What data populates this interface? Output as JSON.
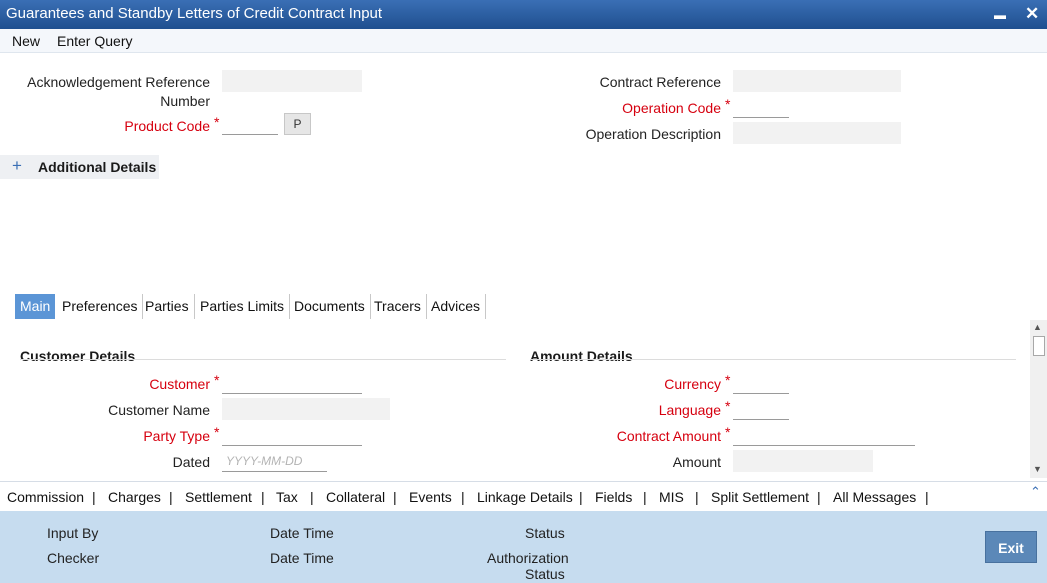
{
  "window": {
    "title": "Guarantees and Standby Letters of Credit Contract Input",
    "minimize_icon": "minimize-icon",
    "close_icon": "close-icon",
    "minimize_glyph": "▬",
    "close_glyph": "✕"
  },
  "menu": {
    "new": "New",
    "enter_query": "Enter Query"
  },
  "header": {
    "ack_ref_label_line1": "Acknowledgement Reference",
    "ack_ref_label_line2": "Number",
    "product_code_label": "Product Code",
    "p_button": "P",
    "contract_ref_label": "Contract Reference",
    "operation_code_label": "Operation Code",
    "operation_desc_label": "Operation Description",
    "required_mark": "*"
  },
  "additional_details": {
    "toggle": "+",
    "label": "Additional Details"
  },
  "tabs": [
    "Main",
    "Preferences",
    "Parties",
    "Parties Limits",
    "Documents",
    "Tracers",
    "Advices"
  ],
  "main": {
    "customer_details": {
      "title": "Customer Details",
      "customer_label": "Customer",
      "customer_name_label": "Customer Name",
      "party_type_label": "Party Type",
      "dated_label": "Dated",
      "dated_placeholder": "YYYY-MM-DD"
    },
    "amount_details": {
      "title": "Amount Details",
      "currency_label": "Currency",
      "language_label": "Language",
      "contract_amount_label": "Contract Amount",
      "amount_label": "Amount"
    }
  },
  "subscreens": [
    "Commission",
    "Charges",
    "Settlement",
    "Tax",
    "Collateral",
    "Events",
    "Linkage Details",
    "Fields",
    "MIS",
    "Split Settlement",
    "All Messages"
  ],
  "subscreen_separator": "|",
  "footer": {
    "input_by": "Input By",
    "checker": "Checker",
    "date_time_1": "Date Time",
    "date_time_2": "Date Time",
    "status": "Status",
    "auth_status_line1": "Authorization",
    "auth_status_line2": "Status",
    "exit": "Exit"
  },
  "scroll": {
    "up_glyph": "▲",
    "down_glyph": "▼",
    "collapse_glyph": "⌃"
  },
  "colors": {
    "title_bar": "#2a5fa3",
    "active_tab": "#5b95d6",
    "required": "#d6000f",
    "footer": "#c6dcef",
    "exit_button": "#5b88b8"
  }
}
